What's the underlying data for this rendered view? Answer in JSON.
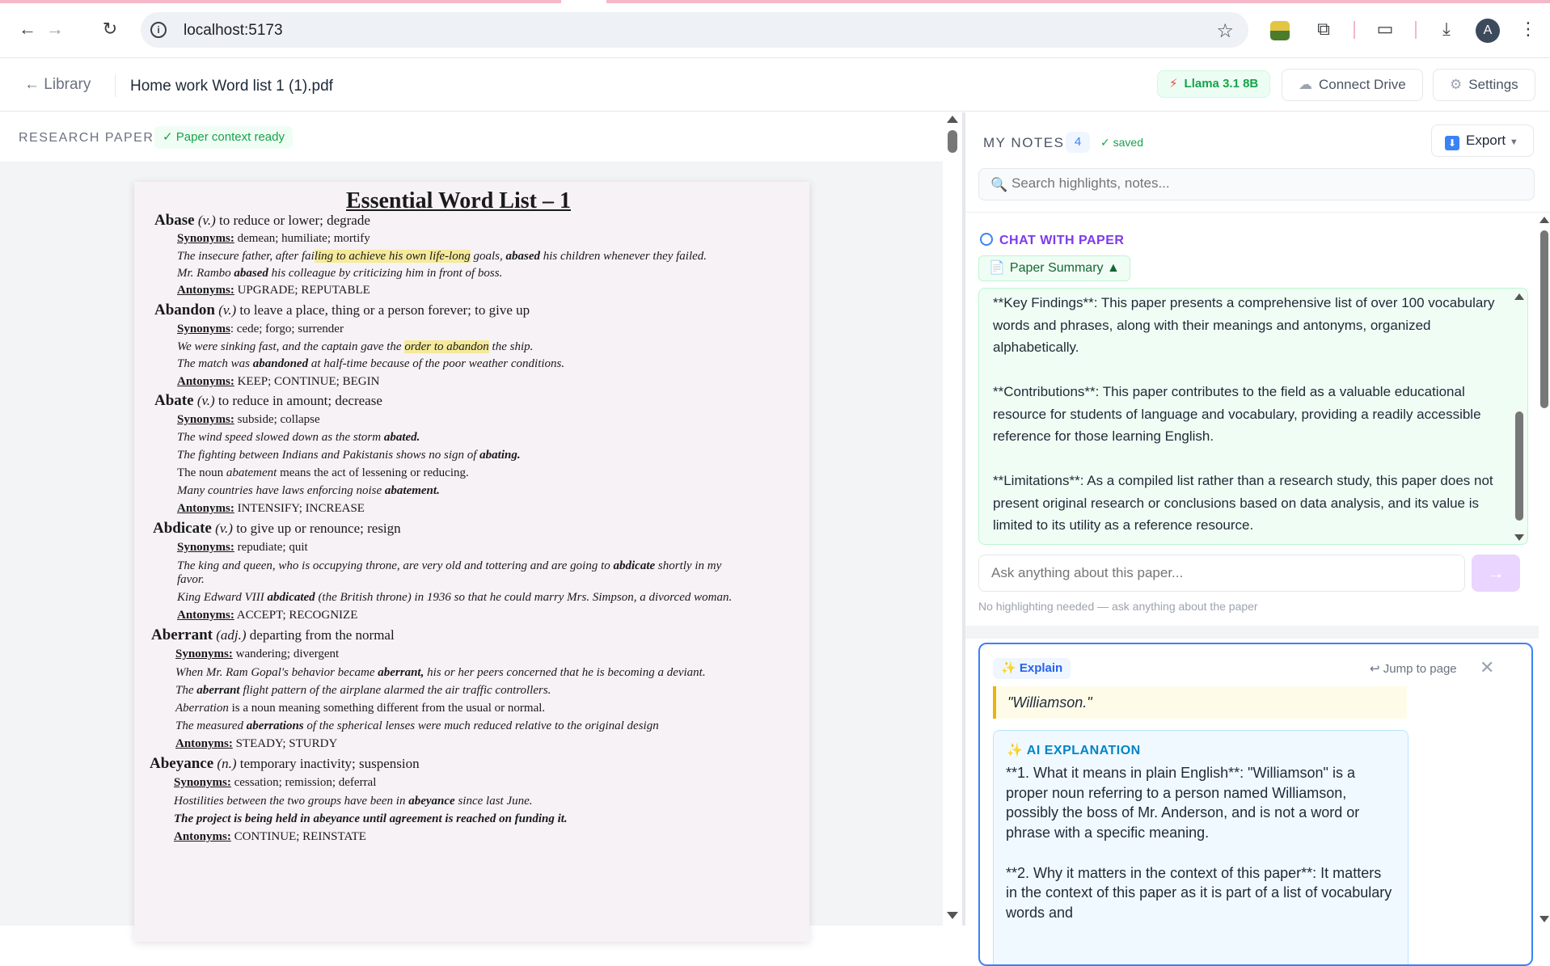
{
  "browser": {
    "url": "localhost:5173",
    "avatar_letter": "A"
  },
  "header": {
    "back_label": "← Library",
    "doc_title": "Home work Word list 1 (1).pdf",
    "model_label": "Llama 3.1 8B",
    "connect_drive_label": "Connect Drive",
    "settings_label": "Settings"
  },
  "left_pane": {
    "label": "RESEARCH PAPER",
    "context_badge": "✓ Paper context ready"
  },
  "paper": {
    "title": "Essential Word List – 1",
    "lines": {
      "l1_word": "Abase",
      "l1_pos": "(v.)",
      "l1_def": "to reduce or lower; degrade",
      "l2_lbl": "Synonyms:",
      "l2_txt": "demean; humiliate; mortify",
      "l3a": "The insecure father, after fai",
      "l3b": "ling to achieve his own life-long",
      "l3c": "goals,",
      "l3d": "abased",
      "l3e": "his children whenever they failed.",
      "l4a": "Mr. Rambo",
      "l4b": "abased",
      "l4c": "his colleague by criticizing him in front of boss.",
      "l5_lbl": "Antonyms:",
      "l5_txt": "UPGRADE; REPUTABLE",
      "l6_word": "Abandon",
      "l6_pos": "(v.)",
      "l6_def": "to leave a place, thing or a person forever; to give up",
      "l7_lbl": "Synonyms",
      "l7_txt": ": cede; forgo; surrender",
      "l8a": "We were sinking fast, and the captain gave the",
      "l8b": "order to abandon",
      "l8c": "the ship.",
      "l9a": "The match was",
      "l9b": "abandoned",
      "l9c": "at half-time because of the poor weather conditions.",
      "l10_lbl": "Antonyms:",
      "l10_txt": "KEEP; CONTINUE; BEGIN",
      "l11_word": "Abate",
      "l11_pos": "(v.)",
      "l11_def": "to reduce in amount; decrease",
      "l12_lbl": "Synonyms:",
      "l12_txt": "subside; collapse",
      "l13a": "The wind speed slowed down as the storm",
      "l13b": "abated.",
      "l14a": "The fighting between Indians and Pakistanis shows no sign of",
      "l14b": "abating.",
      "l15a": "The noun",
      "l15b": "abatement",
      "l15c": "means the act of lessening or reducing.",
      "l16a": "Many countries have laws enforcing noise",
      "l16b": "abatement.",
      "l17_lbl": "Antonyms:",
      "l17_txt": "INTENSIFY; INCREASE",
      "l18_word": "Abdicate",
      "l18_pos": "(v.)",
      "l18_def": "to give up or renounce; resign",
      "l19_lbl": "Synonyms:",
      "l19_txt": "repudiate; quit",
      "l20a": "The king and queen, who is occupying throne, are very old and tottering and are going to",
      "l20b": "abdicate",
      "l20c": "shortly in my",
      "l21": "favor.",
      "l22a": "King Edward VIII",
      "l22b": "abdicated",
      "l22c": "(the British throne) in 1936 so that he could marry Mrs. Simpson, a divorced woman.",
      "l23_lbl": "Antonyms:",
      "l23_txt": "ACCEPT; RECOGNIZE",
      "l24_word": "Aberrant",
      "l24_pos": "(adj.)",
      "l24_def": "departing  from the normal",
      "l25_lbl": "Synonyms:",
      "l25_txt": "wandering; divergent",
      "l26a": "When Mr. Ram Gopal's behavior became",
      "l26b": "aberrant,",
      "l26c": "his or her peers concerned that he is becoming a deviant.",
      "l27a": "The",
      "l27b": "aberrant",
      "l27c": "flight pattern of the airplane alarmed the air traffic controllers.",
      "l28a": "Aberration",
      "l28b": "is a noun meaning something different from the usual or normal.",
      "l29a": "The measured",
      "l29b": "aberrations",
      "l29c": "of the spherical lenses were much reduced relative to the original design",
      "l30_lbl": "Antonyms:",
      "l30_txt": "STEADY; STURDY",
      "l31_word": "Abeyance",
      "l31_pos": "(n.)",
      "l31_def": "temporary inactivity; suspension",
      "l32_lbl": "Synonyms:",
      "l32_txt": "cessation; remission; deferral",
      "l33a": "Hostilities between the two groups have been in",
      "l33b": "abeyance",
      "l33c": "since last June.",
      "l34a": "The project is being held in",
      "l34b": "abeyance",
      "l34c": "until agreement is reached on funding it.",
      "l35_lbl": "Antonyms:",
      "l35_txt": "CONTINUE; REINSTATE"
    }
  },
  "notes": {
    "label": "MY NOTES",
    "count": "4",
    "saved": "✓ saved",
    "export_label": "Export",
    "search_placeholder": "Search highlights, notes..."
  },
  "chat": {
    "title": "CHAT WITH PAPER",
    "summary_toggle": "Paper Summary ▲",
    "summary_text": "**Key Findings**: This paper presents a comprehensive list of over 100 vocabulary words and phrases, along with their meanings and antonyms, organized alphabetically.\n\n**Contributions**: This paper contributes to the field as a valuable educational resource for students of language and vocabulary, providing a readily accessible reference for those learning English.\n\n**Limitations**: As a compiled list rather than a research study, this paper does not present original research or conclusions based on data analysis, and its value is limited to its utility as a reference resource.",
    "ask_placeholder": "Ask anything about this paper...",
    "send_label": "→",
    "hint": "No highlighting needed — ask anything about the paper"
  },
  "note_card": {
    "tag": "Explain",
    "jump_label": "Jump to page",
    "close_label": "✕",
    "quote": "\"Williamson.\"",
    "ai_title": "AI EXPLANATION",
    "ai_text": "**1. What it means in plain English**: \"Williamson\" is a proper noun referring to a person named Williamson, possibly the boss of Mr. Anderson, and is not a word or phrase with a specific meaning.\n\n**2. Why it matters in the context of this paper**: It matters in the context of this paper as it is part of a list of vocabulary words and"
  },
  "colors": {
    "accent_blue": "#3b82f6",
    "accent_purple": "#7c3aed",
    "success_green": "#16a34a",
    "highlight_yellow": "#f4ea9a"
  }
}
